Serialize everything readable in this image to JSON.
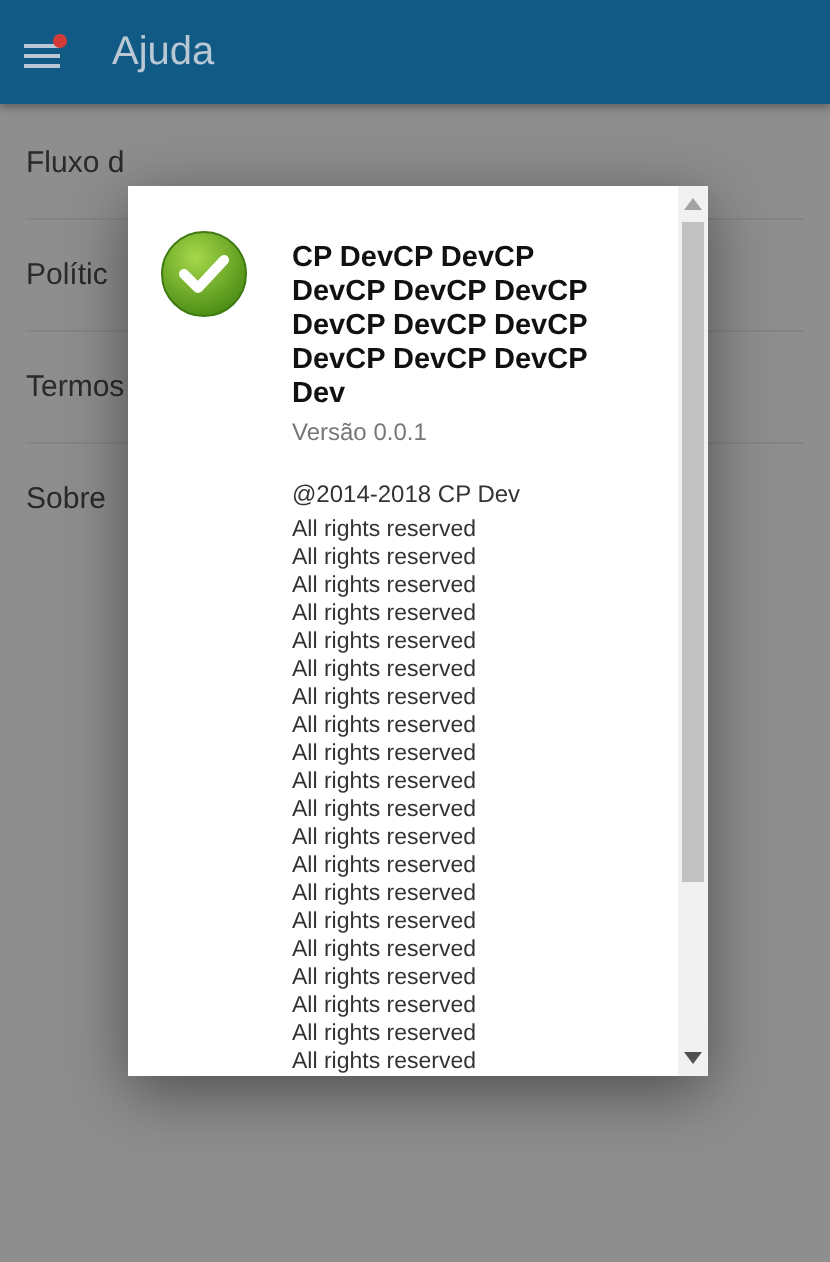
{
  "header": {
    "title": "Ajuda"
  },
  "menu_items": [
    "Fluxo d",
    "Polític",
    "Termos",
    "Sobre"
  ],
  "dialog": {
    "title": "CP DevCP DevCP DevCP DevCP DevCP DevCP DevCP DevCP DevCP DevCP DevCP Dev",
    "version": "Versão 0.0.1",
    "copyright": "@2014-2018 CP Dev",
    "lines": [
      "All rights reserved",
      "All rights reserved",
      "All rights reserved",
      "All rights reserved",
      "All rights reserved",
      "All rights reserved",
      "All rights reserved",
      "All rights reserved",
      "All rights reserved",
      "All rights reserved",
      "All rights reserved",
      "All rights reserved",
      "All rights reserved",
      "All rights reserved",
      "All rights reserved",
      "All rights reserved",
      "All rights reserved",
      "All rights reserved",
      "All rights reserved",
      "All rights reserved"
    ]
  }
}
